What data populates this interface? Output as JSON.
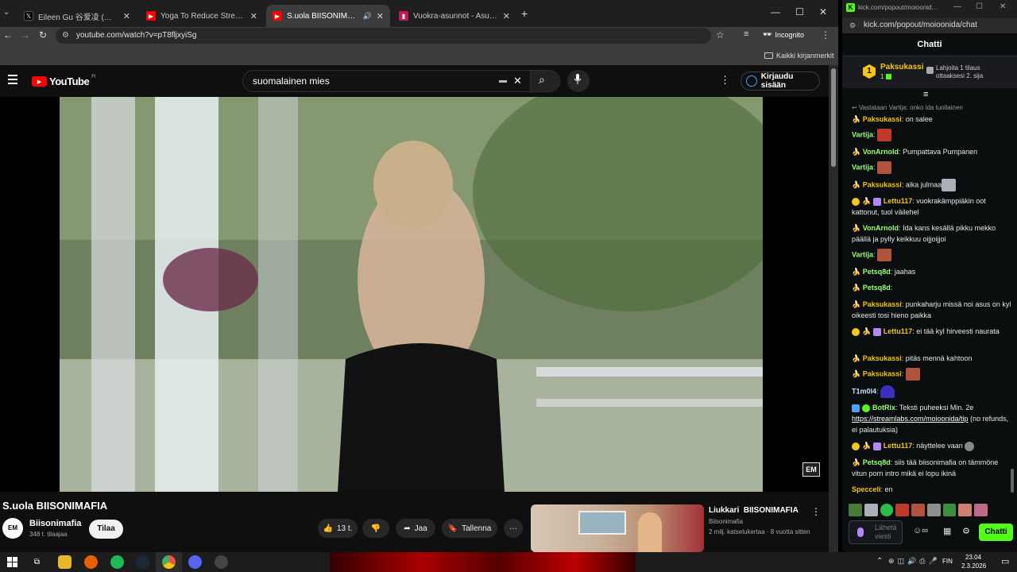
{
  "browser": {
    "tabs": [
      {
        "title": "Eileen Gu 谷爱凌 (@GoEileenGu",
        "favicon": "x-icon"
      },
      {
        "title": "Yoga To Reduce Stress | 30 Min",
        "favicon": "youtube-icon"
      },
      {
        "title": "S.uola BIISONIMAFIA - YouTube",
        "favicon": "youtube-icon"
      },
      {
        "title": "Vuokra-asunnot - Asuntohaku",
        "favicon": "vuokraovi-icon"
      }
    ],
    "url": "youtube.com/watch?v=pT8fljxyiSg",
    "incognito_label": "Incognito",
    "bookmarks_label": "Kaikki kirjanmerkit"
  },
  "youtube": {
    "logo_text": "YouTube",
    "region": "FI",
    "search_value": "suomalainen mies",
    "signin_label": "Kirjaudu sisään",
    "video_title": "S.uola BIISONIMAFIA",
    "channel_name": "Biisonimafia",
    "subscribers": "348 t. tilaajaa",
    "subscribe_label": "Tilaa",
    "likes": "13 t.",
    "share_label": "Jaa",
    "save_label": "Tallenna",
    "watermark": "EM",
    "recommended": {
      "title": "Liukkari  BIISONIMAFIA",
      "channel": "Biisonimafia",
      "meta": "2 milj. katselukertaa · 8 vuotta sitten"
    }
  },
  "kick": {
    "url_short": "kick.com/popout/moioonid...",
    "url": "kick.com/popout/moioonida/chat",
    "header": "Chatti",
    "gift_rank": "1",
    "gift_user": "Paksukassi",
    "gift_count": "1",
    "gift_cta": "Lahjoita 1 tilaus ottaaksesi 2. sija",
    "reply_context": "Vastataan Vartija: onko ida tuollainen",
    "messages": [
      {
        "user": "Paksukassi",
        "text": "on salee",
        "color": "#f5c518"
      },
      {
        "user": "Vartija",
        "text": "",
        "color": "#9bff7b"
      },
      {
        "user": "VonArnold",
        "text": "Pumpattava Pumpanen",
        "color": "#9bff7b"
      },
      {
        "user": "Vartija",
        "text": "",
        "color": "#9bff7b"
      },
      {
        "user": "Paksukassi",
        "text": "aika julmaa",
        "color": "#f5c518"
      },
      {
        "user": "Lettu117",
        "text": "vuokrakämppiäkin oot kattonut, tuol väilehel",
        "color": "#f5c518"
      },
      {
        "user": "VonArnold",
        "text": "Ida kans kesällä pikku mekko päällä ja pylly keikkuu oijjoijjoi",
        "color": "#9bff7b"
      },
      {
        "user": "Vartija",
        "text": "",
        "color": "#9bff7b"
      },
      {
        "user": "Petsq8d",
        "text": "jaahas",
        "color": "#9bff7b"
      },
      {
        "user": "Petsq8d",
        "text": "",
        "color": "#9bff7b"
      },
      {
        "user": "Paksukassi",
        "text": "punkaharju missä noi asus on kyl oikeesti tosi hieno paikka",
        "color": "#f5c518"
      },
      {
        "user": "Lettu117",
        "text": "ei tää kyl hirveesti naurata",
        "color": "#f5c518"
      },
      {
        "user": "Paksukassi",
        "text": "pitäs mennä kahtoon",
        "color": "#f5c518"
      },
      {
        "user": "Paksukassi",
        "text": "",
        "color": "#f5c518"
      },
      {
        "user": "T1m0l4",
        "text": "",
        "color": "#bfe3ff"
      },
      {
        "user": "BotRix",
        "text": "Teksti puheeksi Min. 2e",
        "color": "#9bff7b"
      },
      {
        "user": "Lettu117",
        "text": "näyttelee vaan",
        "color": "#f5c518"
      },
      {
        "user": "Petsq8d",
        "text": "siis tää biisonimafia on tämmöne vitun porn intro mikä ei lopu ikinä",
        "color": "#9bff7b"
      },
      {
        "user": "Specceli",
        "text": "en",
        "color": "#f5c518"
      }
    ],
    "botrix_link": "https://streamlabs.com/moioonida/tip",
    "botrix_suffix": " (no refunds, ei palautuksia)",
    "input_placeholder": "Lähetä viesti",
    "send_label": "Chatti"
  },
  "taskbar": {
    "lang": "FIN",
    "time": "23.04",
    "date": "2.3.2026"
  },
  "colors": {
    "kick_green": "#53fc18",
    "yt_red": "#ff0000",
    "chrome_dark": "#1f1f1f"
  }
}
